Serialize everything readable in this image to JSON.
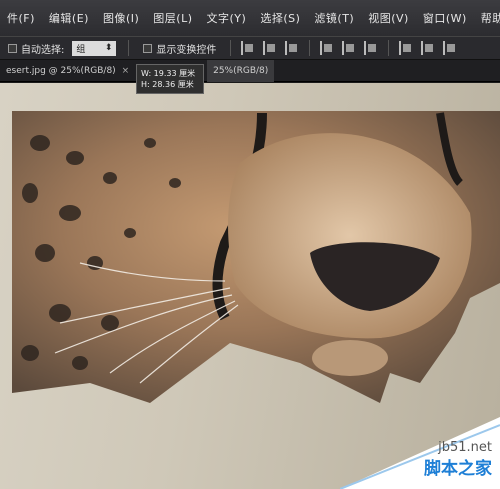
{
  "menu": [
    "件(F)",
    "编辑(E)",
    "图像(I)",
    "图层(L)",
    "文字(Y)",
    "选择(S)",
    "滤镜(T)",
    "视图(V)",
    "窗口(W)",
    "帮助(H)"
  ],
  "options": {
    "auto_select_label": "自动选择:",
    "auto_select_value": "组",
    "show_transform_label": "显示变换控件"
  },
  "tabs": {
    "tab1": "esert.jpg @ 25%(RGB/8)",
    "tab1_close": "×",
    "tab2": "25%(RGB/8)"
  },
  "tooltip": {
    "w": "W: 19.33 厘米",
    "h": "H: 28.36 厘米"
  },
  "watermark": {
    "site": "jb51.net",
    "name": "脚本之家"
  }
}
